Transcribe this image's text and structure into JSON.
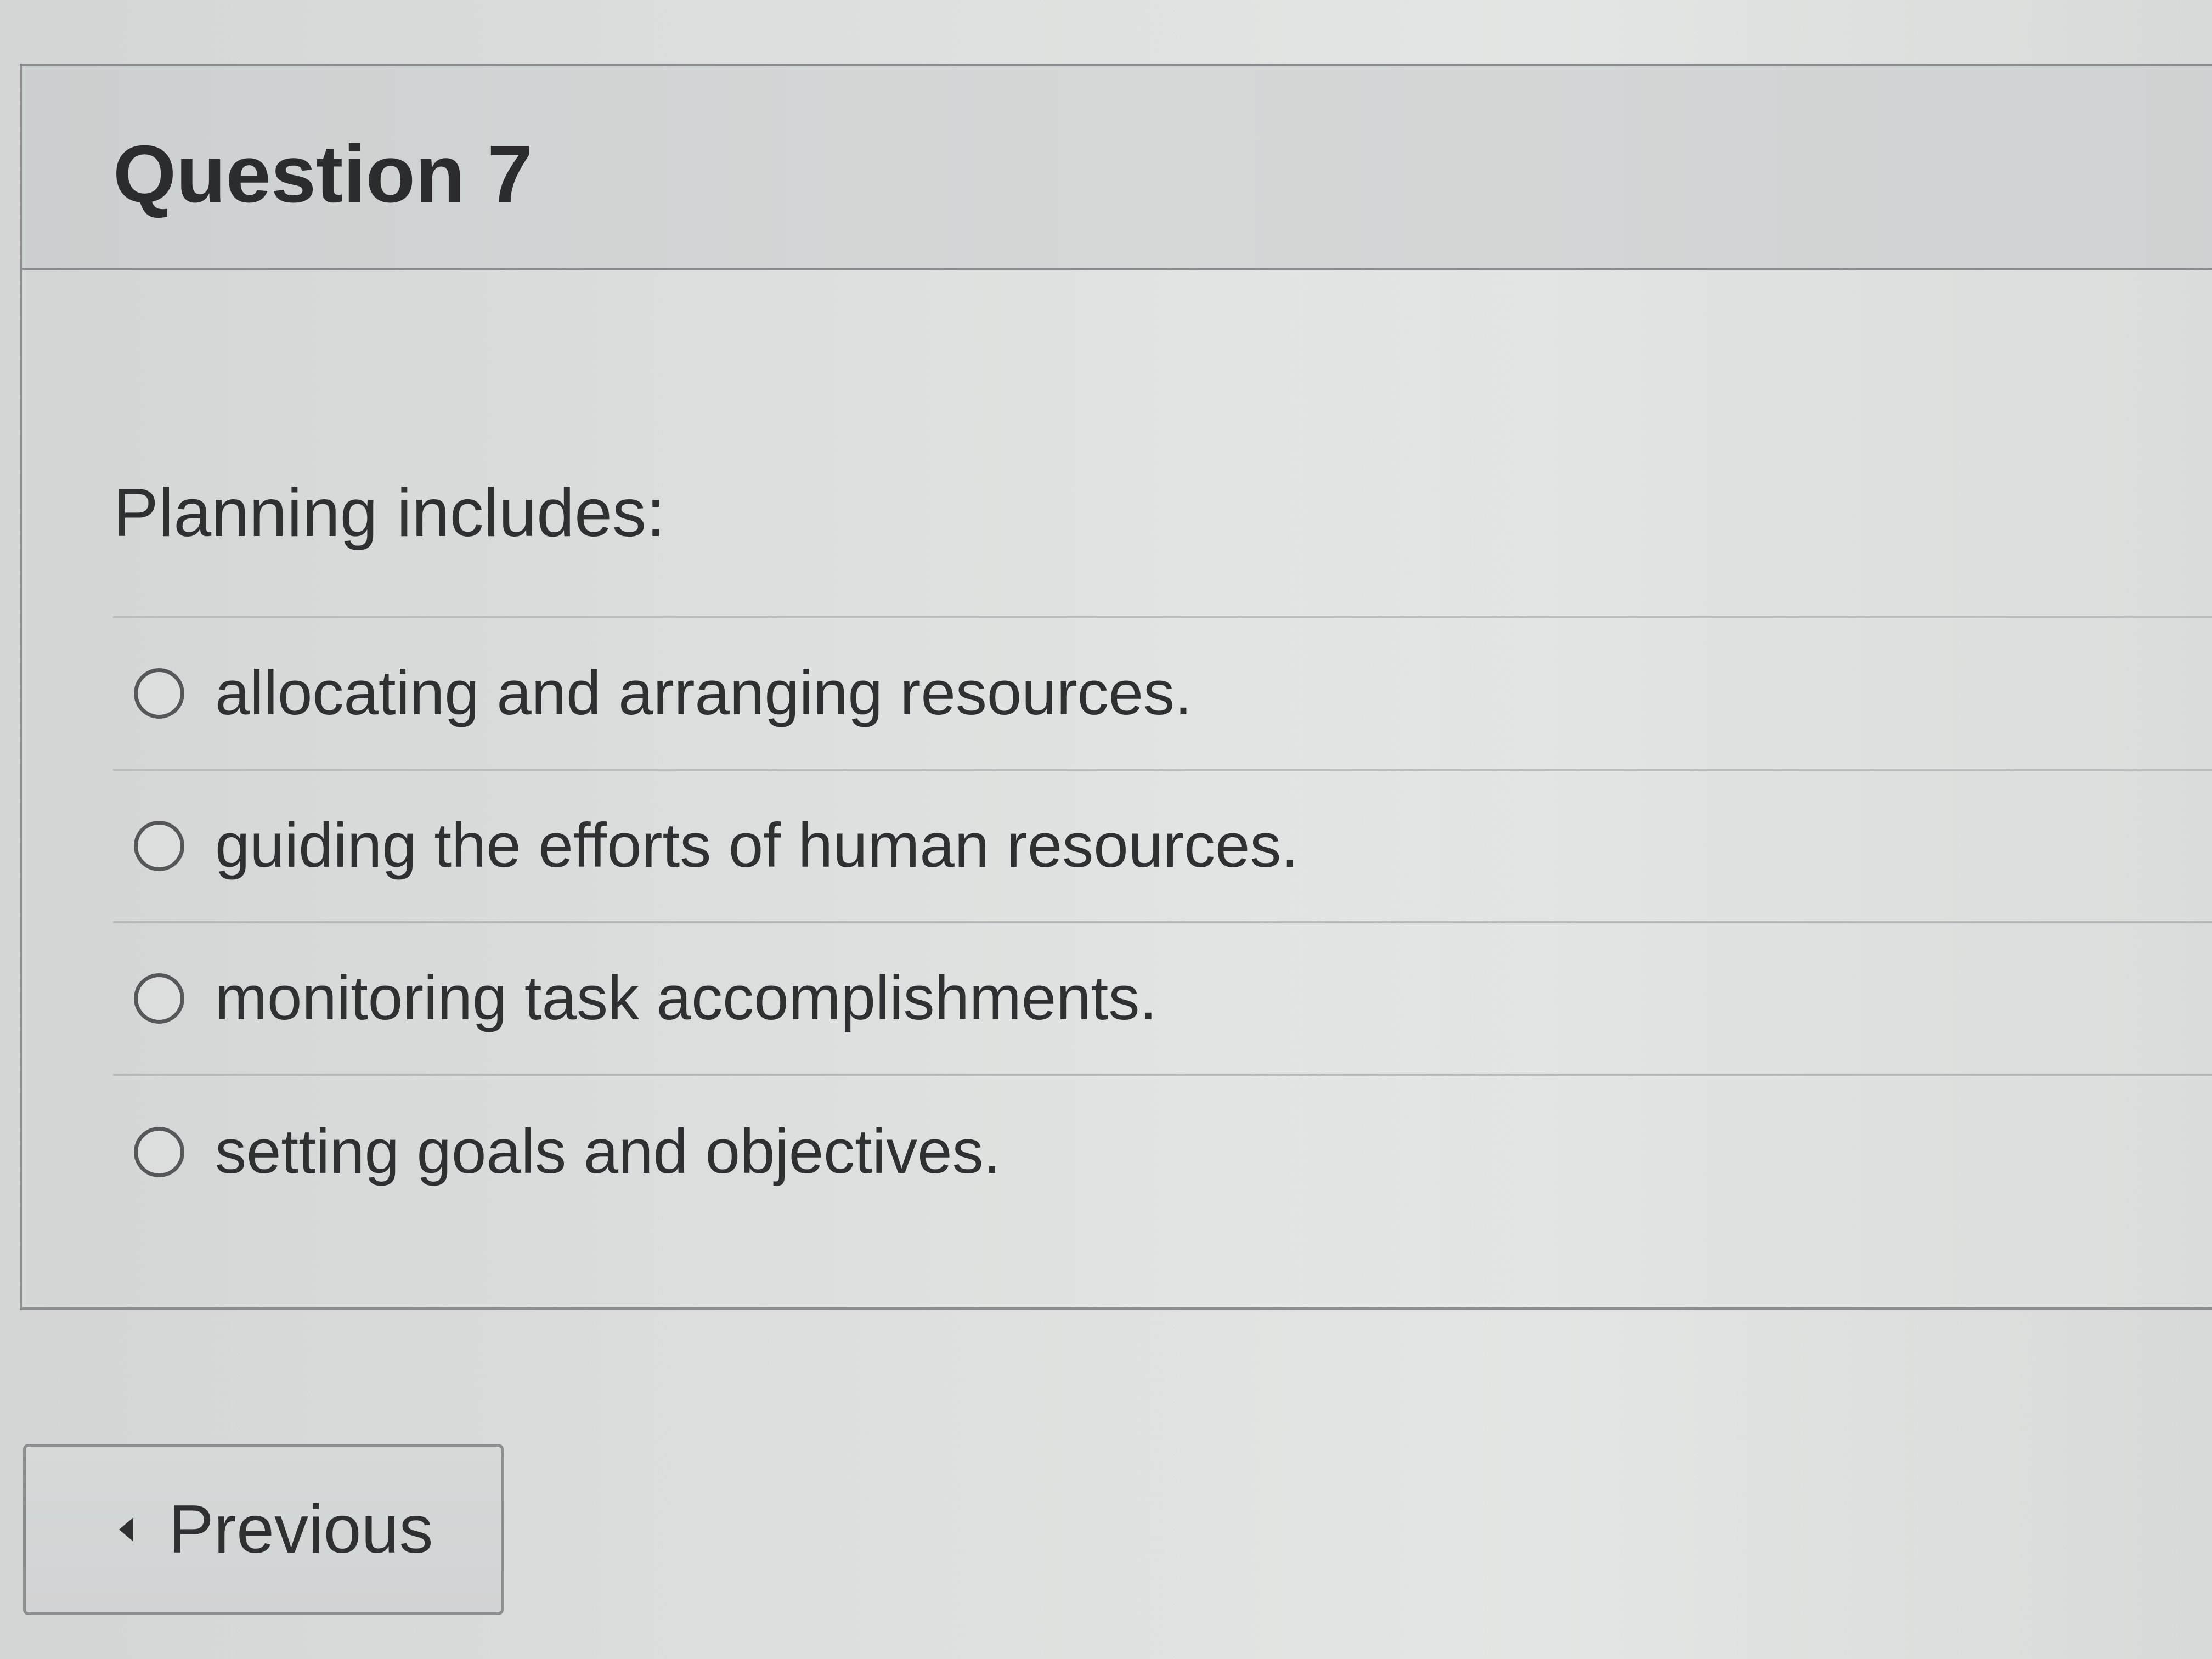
{
  "question": {
    "title": "Question 7",
    "prompt": "Planning includes:",
    "options": [
      {
        "label": "allocating and arranging resources.",
        "selected": false
      },
      {
        "label": "guiding the efforts of human resources.",
        "selected": false
      },
      {
        "label": "monitoring task accomplishments.",
        "selected": false
      },
      {
        "label": "setting goals and objectives.",
        "selected": false
      }
    ]
  },
  "navigation": {
    "previous_label": "Previous",
    "previous_icon": "caret-left-icon"
  },
  "colors": {
    "text": "#2e3031",
    "border": "#8b8e8f",
    "divider": "#b8bbbb",
    "background": "#dfe1e0"
  }
}
